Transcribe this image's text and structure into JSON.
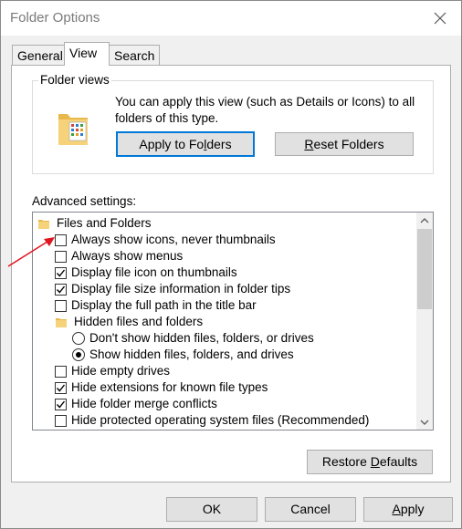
{
  "window": {
    "title": "Folder Options"
  },
  "tabs": [
    {
      "label": "General",
      "active": false
    },
    {
      "label": "View",
      "active": true
    },
    {
      "label": "Search",
      "active": false
    }
  ],
  "folder_views": {
    "legend": "Folder views",
    "description": "You can apply this view (such as Details or Icons) to all folders of this type.",
    "apply_button": {
      "pre": "Apply to Fo",
      "accel": "l",
      "post": "ders"
    },
    "reset_button": {
      "pre": "",
      "accel": "R",
      "post": "eset Folders"
    }
  },
  "advanced": {
    "label": "Advanced settings:",
    "items": [
      {
        "kind": "folder",
        "label": "Files and Folders",
        "indent": 0
      },
      {
        "kind": "checkbox",
        "label": "Always show icons, never thumbnails",
        "checked": false
      },
      {
        "kind": "checkbox",
        "label": "Always show menus",
        "checked": false
      },
      {
        "kind": "checkbox",
        "label": "Display file icon on thumbnails",
        "checked": true
      },
      {
        "kind": "checkbox",
        "label": "Display file size information in folder tips",
        "checked": true
      },
      {
        "kind": "checkbox",
        "label": "Display the full path in the title bar",
        "checked": false
      },
      {
        "kind": "folder",
        "label": "Hidden files and folders",
        "indent": 1
      },
      {
        "kind": "radio",
        "label": "Don't show hidden files, folders, or drives",
        "selected": false
      },
      {
        "kind": "radio",
        "label": "Show hidden files, folders, and drives",
        "selected": true
      },
      {
        "kind": "checkbox",
        "label": "Hide empty drives",
        "checked": false
      },
      {
        "kind": "checkbox",
        "label": "Hide extensions for known file types",
        "checked": true
      },
      {
        "kind": "checkbox",
        "label": "Hide folder merge conflicts",
        "checked": true
      },
      {
        "kind": "checkbox",
        "label": "Hide protected operating system files (Recommended)",
        "checked": false
      }
    ]
  },
  "restore_button": {
    "pre": "Restore ",
    "accel": "D",
    "post": "efaults"
  },
  "footer": {
    "ok": "OK",
    "cancel": "Cancel",
    "apply": {
      "pre": "",
      "accel": "A",
      "post": "pply"
    }
  },
  "colors": {
    "accent": "#0078d7",
    "annotation_arrow": "#e0141e",
    "folder": "#f6d27a"
  }
}
